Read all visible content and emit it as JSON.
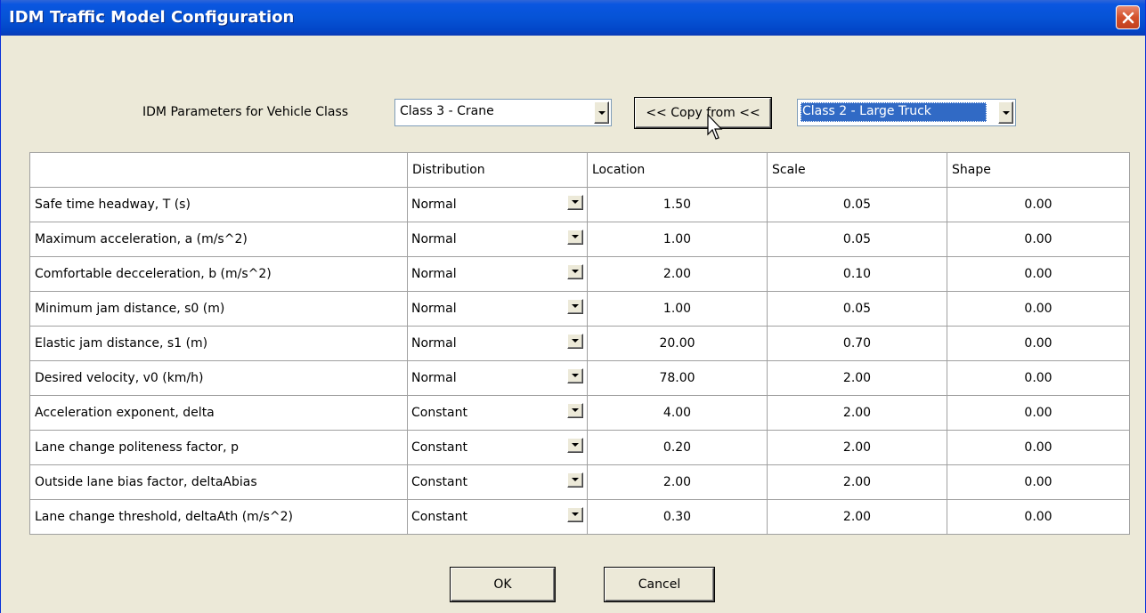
{
  "window": {
    "title": "IDM Traffic Model Configuration"
  },
  "vehicle_class": {
    "label": "IDM Parameters for Vehicle Class",
    "selected": "Class 3 - Crane",
    "copy_button": "<< Copy from <<",
    "copy_source": "Class 2 - Large Truck"
  },
  "table": {
    "headers": [
      "",
      "Distribution",
      "Location",
      "Scale",
      "Shape"
    ],
    "rows": [
      {
        "name": "Safe time headway, T (s)",
        "distribution": "Normal",
        "location": "1.50",
        "scale": "0.05",
        "shape": "0.00"
      },
      {
        "name": "Maximum acceleration, a (m/s^2)",
        "distribution": "Normal",
        "location": "1.00",
        "scale": "0.05",
        "shape": "0.00"
      },
      {
        "name": "Comfortable decceleration, b (m/s^2)",
        "distribution": "Normal",
        "location": "2.00",
        "scale": "0.10",
        "shape": "0.00"
      },
      {
        "name": "Minimum jam distance, s0 (m)",
        "distribution": "Normal",
        "location": "1.00",
        "scale": "0.05",
        "shape": "0.00"
      },
      {
        "name": "Elastic jam distance, s1 (m)",
        "distribution": "Normal",
        "location": "20.00",
        "scale": "0.70",
        "shape": "0.00"
      },
      {
        "name": "Desired velocity, v0 (km/h)",
        "distribution": "Normal",
        "location": "78.00",
        "scale": "2.00",
        "shape": "0.00"
      },
      {
        "name": "Acceleration exponent, delta",
        "distribution": "Constant",
        "location": "4.00",
        "scale": "2.00",
        "shape": "0.00"
      },
      {
        "name": "Lane change politeness factor, p",
        "distribution": "Constant",
        "location": "0.20",
        "scale": "2.00",
        "shape": "0.00"
      },
      {
        "name": "Outside lane bias factor, deltaAbias",
        "distribution": "Constant",
        "location": "2.00",
        "scale": "2.00",
        "shape": "0.00"
      },
      {
        "name": "Lane change threshold, deltaAth (m/s^2)",
        "distribution": "Constant",
        "location": "0.30",
        "scale": "2.00",
        "shape": "0.00"
      }
    ]
  },
  "buttons": {
    "ok": "OK",
    "cancel": "Cancel"
  },
  "colors": {
    "titlebar": "#0653d6",
    "selection": "#316ac5",
    "dialog_bg": "#ece9d8"
  },
  "icons": {
    "close": "close-icon",
    "dropdown": "chevron-down-icon",
    "cursor": "mouse-pointer-icon"
  }
}
